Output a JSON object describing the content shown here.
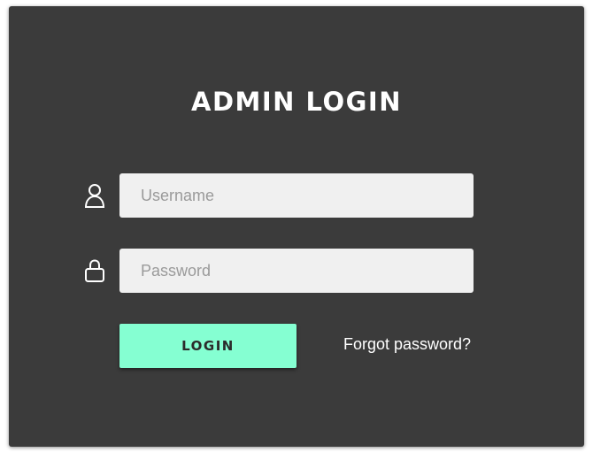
{
  "login_form": {
    "title": "Admin Login",
    "username": {
      "icon": "user-icon",
      "placeholder": "Username",
      "value": ""
    },
    "password": {
      "icon": "lock-icon",
      "placeholder": "Password",
      "value": ""
    },
    "login_button_label": "Login",
    "forgot_password_label": "Forgot password?"
  },
  "colors": {
    "card_background": "#3b3b3b",
    "input_background": "#f0f0f0",
    "accent": "#85ffd2",
    "text": "#ffffff"
  }
}
